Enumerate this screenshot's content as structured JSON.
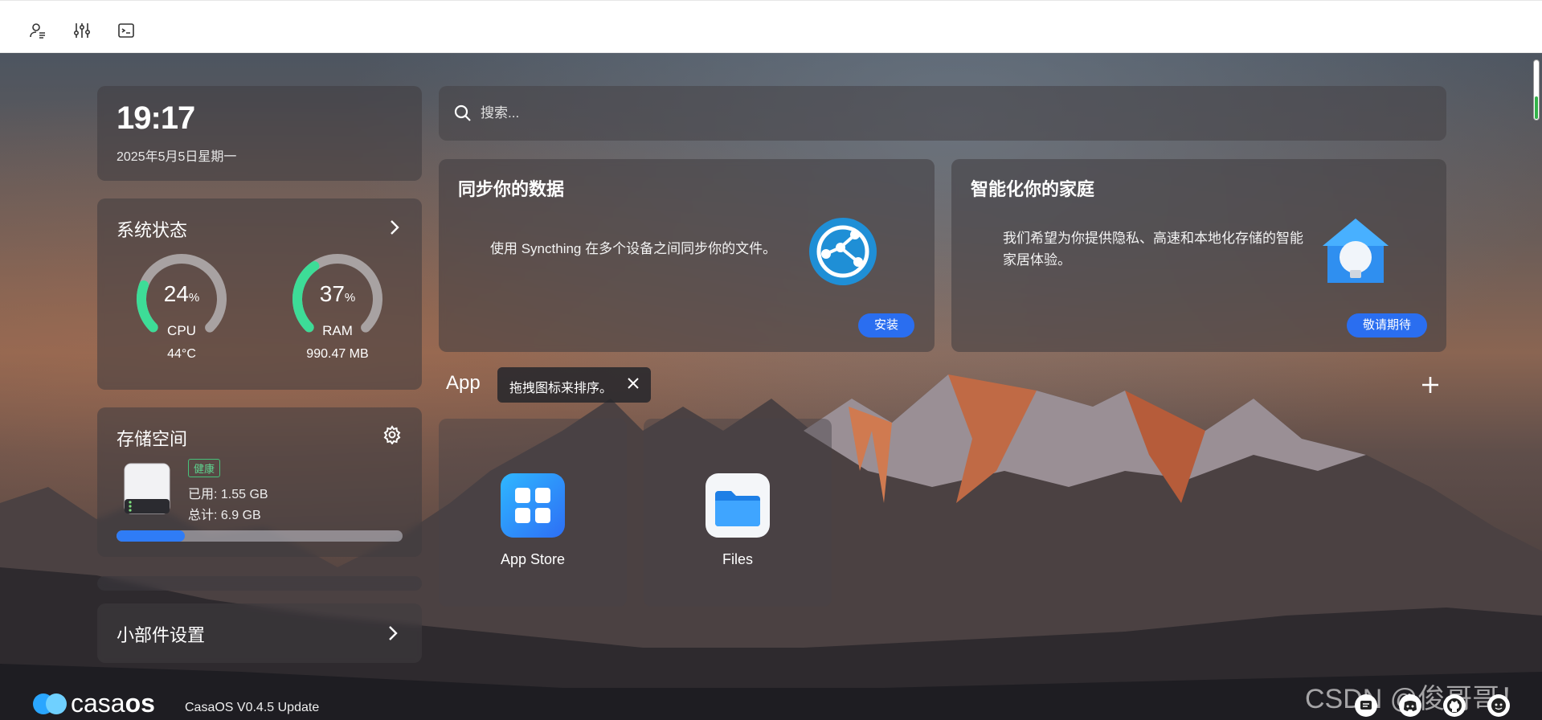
{
  "toolbar": {
    "icons": [
      "user-list-icon",
      "sliders-icon",
      "terminal-icon"
    ]
  },
  "clock": {
    "time": "19:17",
    "date": "2025年5月5日星期一"
  },
  "system_status": {
    "title": "系统状态",
    "cpu": {
      "value": "24",
      "unit": "%",
      "label": "CPU",
      "sub": "44°C",
      "fraction": 0.24
    },
    "ram": {
      "value": "37",
      "unit": "%",
      "label": "RAM",
      "sub": "990.47 MB",
      "fraction": 0.37
    }
  },
  "storage": {
    "title": "存储空间",
    "badge": "健康",
    "used": "已用: 1.55 GB",
    "total": "总计: 6.9 GB",
    "fraction": 0.24
  },
  "widget_settings": {
    "label": "小部件设置"
  },
  "search": {
    "placeholder": "搜索..."
  },
  "promo_sync": {
    "title": "同步你的数据",
    "text": "使用 Syncthing 在多个设备之间同步你的文件。",
    "button": "安装"
  },
  "promo_home": {
    "title": "智能化你的家庭",
    "text": "我们希望为你提供隐私、高速和本地化存储的智能家居体验。",
    "button": "敬请期待"
  },
  "apps": {
    "title": "App",
    "tooltip": "拖拽图标来排序。",
    "items": [
      {
        "name": "App Store",
        "icon": "app-store-icon"
      },
      {
        "name": "Files",
        "icon": "files-icon"
      }
    ]
  },
  "footer": {
    "logo": "casaos",
    "version": "CasaOS V0.4.5 Update",
    "watermark": "CSDN @俊哥哥！",
    "icons": [
      "feedback-icon",
      "discord-icon",
      "github-icon",
      "support-icon"
    ]
  },
  "colors": {
    "accent": "#2a6ef0",
    "gauge": "#3ddc97",
    "healthy": "#47c27a"
  }
}
